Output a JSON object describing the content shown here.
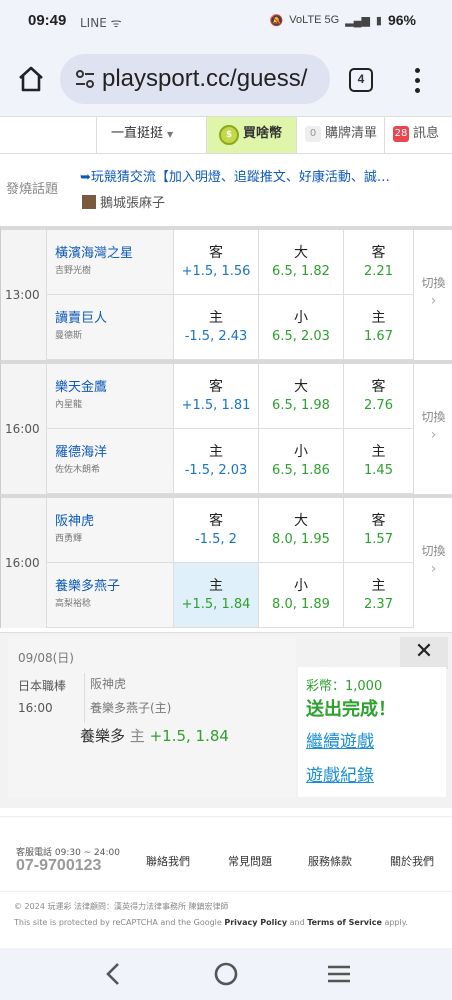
{
  "status_bar": {
    "time": "09:49",
    "notif_icons": "LINE ᯤ",
    "right_icons": "VoLTE 5G",
    "battery": "96%"
  },
  "browser": {
    "url": "playsport.cc/guess/",
    "tab_count": "4"
  },
  "topbar": {
    "filter_label": "一直挺挺",
    "buy_label": "買啥幣",
    "buy_badge": "$",
    "cart_count": "0",
    "cart_label": "購牌清單",
    "msg_count": "28",
    "msg_label": "訊息"
  },
  "hot_topic": {
    "label": "發燒話題",
    "topic": "➥玩競猜交流【加入明燈、追蹤推文、好康活動、誠…",
    "author": "鵝城張麻子"
  },
  "games": [
    {
      "time": "13:00",
      "switch_label": "切換",
      "away": {
        "name": "橫濱海灣之星",
        "pitcher": "吉野光樹",
        "spread_k": "客",
        "spread_v": "+1.5, 1.56",
        "total_k": "大",
        "total_v": "6.5, 1.82",
        "ml_k": "客",
        "ml_v": "2.21"
      },
      "home": {
        "name": "讀賣巨人",
        "pitcher": "曼德斯",
        "spread_k": "主",
        "spread_v": "-1.5, 2.43",
        "total_k": "小",
        "total_v": "6.5, 2.03",
        "ml_k": "主",
        "ml_v": "1.67"
      }
    },
    {
      "time": "16:00",
      "switch_label": "切換",
      "away": {
        "name": "樂天金鷹",
        "pitcher": "內星龍",
        "spread_k": "客",
        "spread_v": "+1.5, 1.81",
        "total_k": "大",
        "total_v": "6.5, 1.98",
        "ml_k": "客",
        "ml_v": "2.76"
      },
      "home": {
        "name": "羅德海洋",
        "pitcher": "佐佐木朗希",
        "spread_k": "主",
        "spread_v": "-1.5, 2.03",
        "total_k": "小",
        "total_v": "6.5, 1.86",
        "ml_k": "主",
        "ml_v": "1.45"
      }
    },
    {
      "time": "16:00",
      "switch_label": "切換",
      "away": {
        "name": "阪神虎",
        "pitcher": "西勇輝",
        "spread_k": "客",
        "spread_v": "-1.5, 2",
        "total_k": "大",
        "total_v": "8.0, 1.95",
        "ml_k": "客",
        "ml_v": "1.57"
      },
      "home": {
        "name": "養樂多燕子",
        "pitcher": "高梨裕稔",
        "spread_k": "主",
        "spread_v": "+1.5, 1.84",
        "total_k": "小",
        "total_v": "8.0, 1.89",
        "ml_k": "主",
        "ml_v": "2.37"
      }
    }
  ],
  "bet_popup": {
    "date": "09/08(日)",
    "league": "日本職棒",
    "time": "16:00",
    "team1": "阪神虎",
    "team2": "養樂多燕子(主)",
    "bet_team": "養樂多",
    "bet_side": "主",
    "bet_odds": "+1.5, 1.84",
    "fee": "彩幣：1,000",
    "done": "送出完成！",
    "continue": "繼續遊戲",
    "history": "遊戲紀錄",
    "close": "✕"
  },
  "footer": {
    "service_hours": "客服電話 09:30 ~ 24:00",
    "phone": "07-9700123",
    "links": [
      "聯絡我們",
      "常見問題",
      "服務條款",
      "關於我們"
    ],
    "copyright": "© 2024 玩運彩  法律顧問：漢英得力法律事務所 陳鎮宏律師",
    "recaptcha_pre": "This site is protected by reCAPTCHA and the Google ",
    "privacy": "Privacy Policy",
    "and": " and ",
    "terms": "Terms of Service",
    "apply": " apply."
  }
}
